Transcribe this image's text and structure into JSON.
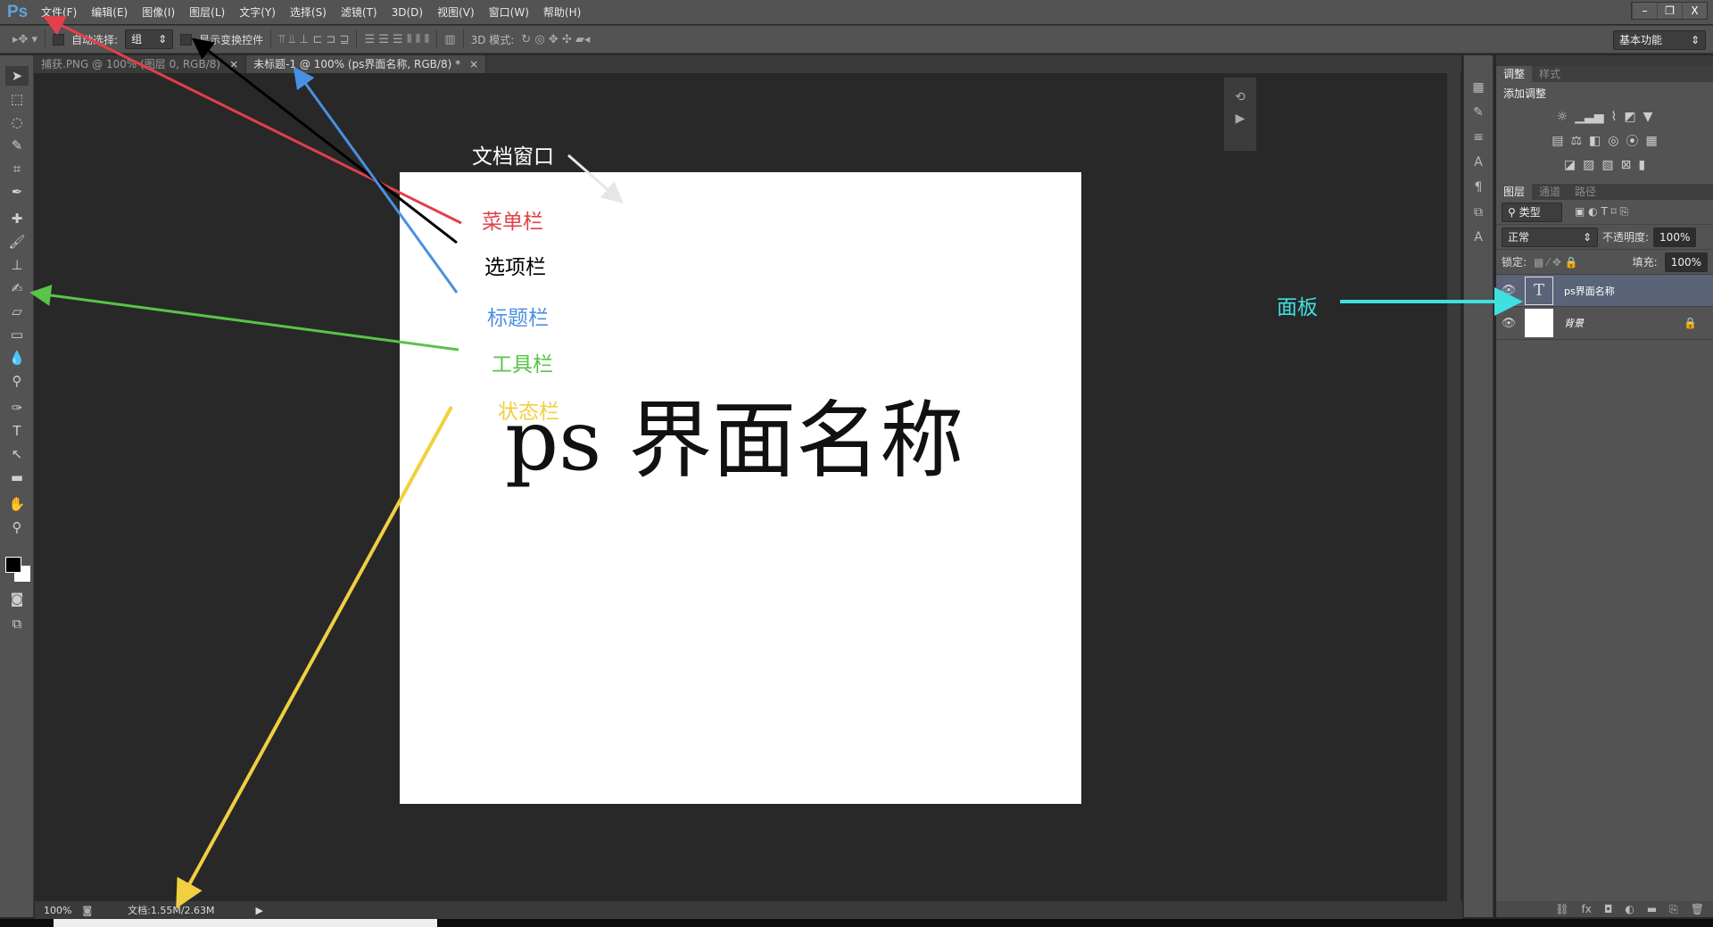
{
  "app": {
    "logo": "Ps"
  },
  "menu": [
    "文件(F)",
    "编辑(E)",
    "图像(I)",
    "图层(L)",
    "文字(Y)",
    "选择(S)",
    "滤镜(T)",
    "3D(D)",
    "视图(V)",
    "窗口(W)",
    "帮助(H)"
  ],
  "window_controls": {
    "minimize": "–",
    "restore": "❐",
    "close": "X"
  },
  "options": {
    "auto_select_label": "自动选择:",
    "auto_select_value": "组",
    "show_transform_label": "显示变换控件",
    "mode_3d_label": "3D 模式:",
    "workspace": "基本功能"
  },
  "tabs": [
    {
      "label": "捕获.PNG @ 100% (图层 0, RGB/8)",
      "close": "×"
    },
    {
      "label": "未标题-1 @ 100% (ps界面名称, RGB/8) *",
      "close": "×"
    }
  ],
  "canvas": {
    "text": "ps 界面名称"
  },
  "panels": {
    "adjust_tabs": [
      "调整",
      "样式"
    ],
    "add_adjustment": "添加调整",
    "layer_tabs": [
      "图层",
      "通道",
      "路径"
    ],
    "filter_kind": "类型",
    "blend_mode": "正常",
    "opacity_label": "不透明度:",
    "opacity": "100%",
    "lock_label": "锁定:",
    "fill_label": "填充:",
    "fill": "100%",
    "layers": [
      {
        "name": "ps界面名称",
        "type": "text",
        "selected": true
      },
      {
        "name": "背景",
        "type": "background",
        "selected": false
      }
    ]
  },
  "status": {
    "zoom": "100%",
    "doc": "文档:1.55M/2.63M"
  },
  "annotations": {
    "doc_window": "文档窗口",
    "menubar": "菜单栏",
    "optionsbar": "选项栏",
    "titlebar": "标题栏",
    "toolbar": "工具栏",
    "statusbar": "状态栏",
    "panel": "面板",
    "colors": {
      "menubar": "#e2404a",
      "optionsbar": "#000000",
      "titlebar": "#4a90e2",
      "toolbar": "#5ac34a",
      "statusbar": "#f0d040",
      "panel": "#3fe0e0",
      "doc_window": "#e6e6e6"
    }
  }
}
